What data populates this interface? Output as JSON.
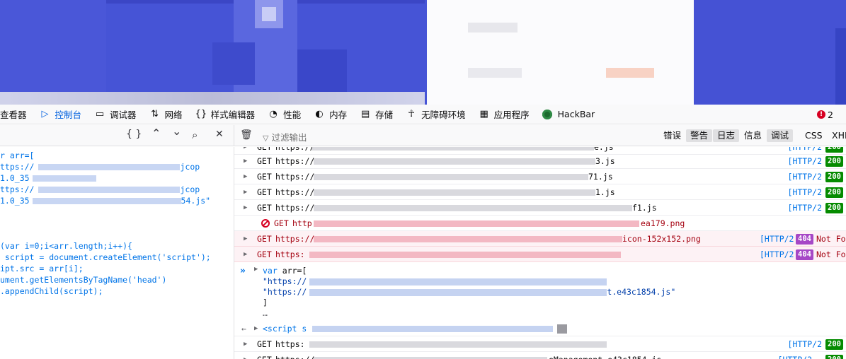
{
  "tabs": {
    "inspector": "查看器",
    "console": "控制台",
    "debugger": "调试器",
    "network": "网络",
    "style_editor": "样式编辑器",
    "performance": "性能",
    "memory": "内存",
    "storage": "存储",
    "accessibility": "无障碍环境",
    "application": "应用程序",
    "hackbar": "HackBar",
    "error_count": "2"
  },
  "editor_toolbar": {
    "pretty_print": "{ }",
    "up": "⌃",
    "down": "⌄",
    "search": "⌕",
    "close": "✕"
  },
  "editor_lines": [
    "r arr=[",
    "ttps://",
    "jcop",
    "1.0_35",
    "ttps://",
    "jcop",
    "1.0_35",
    "54.js\"",
    "(var i=0;i<arr.length;i++){",
    " script = document.createElement('script');",
    "ipt.src = arr[i];",
    "ument.getElementsByTagName('head')",
    ".appendChild(script);"
  ],
  "console_toolbar": {
    "filter_placeholder": "过滤输出",
    "categories": [
      "错误",
      "警告",
      "日志",
      "信息",
      "调试",
      "CSS",
      "XHR"
    ]
  },
  "rows": [
    {
      "method": "GET",
      "url": "https://",
      "tail": "e.js",
      "http": "[HTTP/2",
      "status": "200"
    },
    {
      "method": "GET",
      "url": "https://",
      "tail": "3.js",
      "http": "[HTTP/2",
      "status": "200"
    },
    {
      "method": "GET",
      "url": "https://",
      "tail": "71.js",
      "http": "[HTTP/2",
      "status": "200"
    },
    {
      "method": "GET",
      "url": "https://",
      "tail": "1.js",
      "http": "[HTTP/2",
      "status": "200"
    },
    {
      "method": "GET",
      "url": "https://",
      "tail": "f1.js",
      "http": "[HTTP/2",
      "status": "200"
    },
    {
      "method": "GET",
      "url": "http",
      "tail": "ea179.png"
    },
    {
      "method": "GET",
      "url": "https://",
      "tail": "icon-152x152.png",
      "http": "[HTTP/2",
      "status": "404",
      "status_text": "Not Fou"
    },
    {
      "method": "GET",
      "url": "https:",
      "tail": "",
      "http": "[HTTP/2",
      "status": "404",
      "status_text": "Not Fou"
    }
  ],
  "input_block": {
    "prompt": "»",
    "line1_kw": "var",
    "line1_rest": " arr=[",
    "line2": "\"https://",
    "line3": "\"https://",
    "line3_tail": "t.e43c1854.js\"",
    "line4": "]",
    "line5": "…"
  },
  "result": {
    "arrow": "←",
    "tag": "<script s"
  },
  "bottom_rows": [
    {
      "method": "GET",
      "url": "https:",
      "http": "[HTTP/2",
      "status": "200"
    },
    {
      "method": "GET",
      "url": "https://",
      "tail": "eManagement.e43c1854.js",
      "http": "[HTTP/2",
      "status": "200"
    }
  ]
}
